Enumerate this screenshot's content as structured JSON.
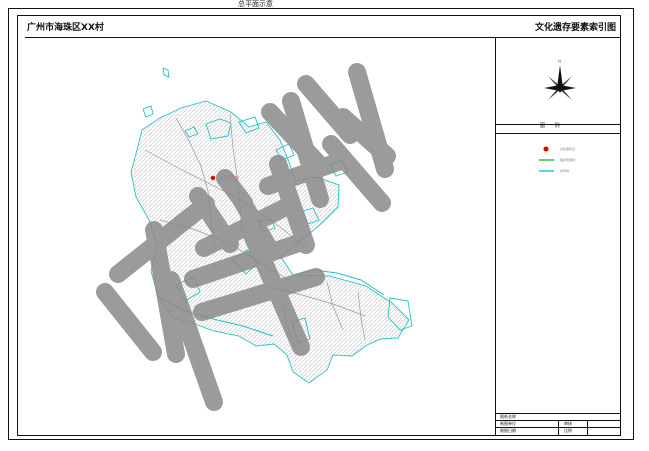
{
  "map": {
    "place_name": "广州市海珠区XX村",
    "sheet_title": "文化遗存要素索引图",
    "top_mark": "总平面示意",
    "north_label": "N",
    "watermark": "样例",
    "legend_title": "图 例",
    "legend": [
      {
        "symbol": "red-dot",
        "label": "文化遗存点",
        "color": "#e60000"
      },
      {
        "symbol": "green-line",
        "label": "保护范围线",
        "color": "#27c027"
      },
      {
        "symbol": "cyan-line",
        "label": "村界线",
        "color": "#1fc3ca"
      }
    ],
    "map_point_label": "文化遗存",
    "metadata": {
      "row1_label": "图纸名称",
      "row2_left": "制图单位",
      "row2_right": "审核",
      "row3_left": "制图日期",
      "row3_right": "比例"
    },
    "colors": {
      "boundary": "#1fc3ca",
      "road": "#9a9a9a",
      "frame": "#111111",
      "watermark": "#8a8a8a"
    }
  }
}
